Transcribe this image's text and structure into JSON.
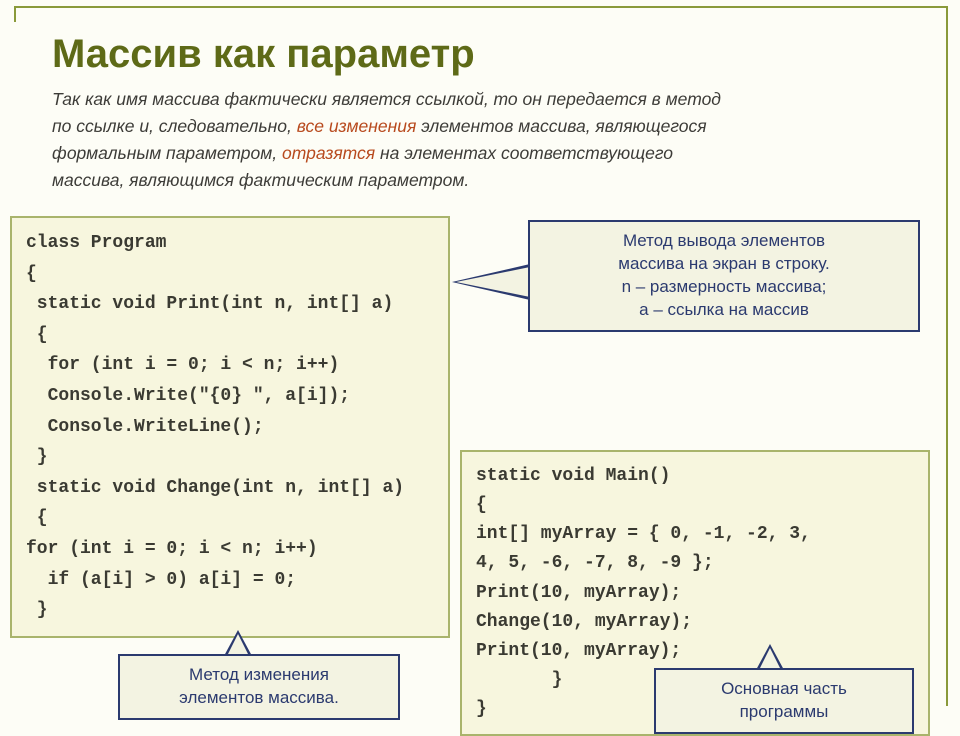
{
  "title": "Массив как параметр",
  "intro": {
    "line1a": "Так как имя массива фактически является ссылкой, то он передается в метод",
    "line2a": "по ссылке и, следовательно, ",
    "line2b": "все изменения",
    "line2c": " элементов массива, являющегося",
    "line3a": "формальным параметром, ",
    "line3b": "отразятся",
    "line3c": " на элементах соответствующего",
    "line4": "массива, являющимся фактическим параметром."
  },
  "code_left": "class Program\n{\n static void Print(int n, int[] a)\n {\n  for (int i = 0; i < n; i++)\n  Console.Write(\"{0} \", a[i]);\n  Console.WriteLine();\n }\n static void Change(int n, int[] a)\n {\nfor (int i = 0; i < n; i++)\n  if (a[i] > 0) a[i] = 0;\n }",
  "code_right": "static void Main()\n{\nint[] myArray = { 0, -1, -2, 3,\n4, 5, -6, -7, 8, -9 };\nPrint(10, myArray);\nChange(10, myArray);\nPrint(10, myArray);\n       }\n}",
  "callouts": {
    "top": "Метод вывода элементов\nмассива  на экран в строку.\nn – размерность массива;\na – ссылка на массив",
    "bl": "Метод изменения\nэлементов массива.",
    "br": "Основная часть\nпрограммы"
  }
}
